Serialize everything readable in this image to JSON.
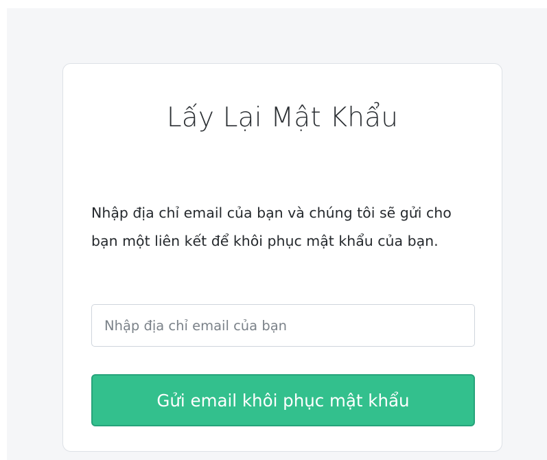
{
  "reset_form": {
    "title": "Lấy Lại Mật Khẩu",
    "description": "Nhập địa chỉ email của bạn và chúng tôi sẽ gửi cho bạn một liên kết để khôi phục mật khẩu của bạn.",
    "email_input": {
      "value": "",
      "placeholder": "Nhập địa chỉ email của bạn"
    },
    "submit_label": "Gửi email khôi phục mật khẩu"
  },
  "colors": {
    "page_background": "#f5f6f8",
    "card_background": "#ffffff",
    "card_border": "#dde1e6",
    "button_background": "#33c08d",
    "button_border": "#25a37a",
    "button_text": "#ffffff",
    "text": "#25292d",
    "placeholder_text": "#7b8289"
  }
}
